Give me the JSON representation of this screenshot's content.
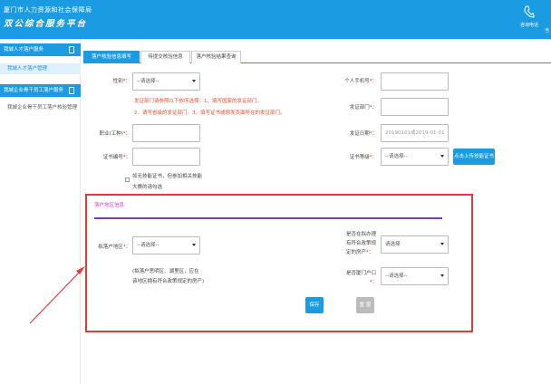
{
  "header": {
    "line1": "厦门市人力资源和社会保障局",
    "line2": "双公综合服务平台",
    "phone_label": "咨询电话",
    "edge_text": "当"
  },
  "sidebar": {
    "groups": [
      {
        "label": "我城人才落户服务",
        "subitems": [
          "我城人才落户管理"
        ]
      },
      {
        "label": "我城企业骨干员工落户服务",
        "subitems": [
          "我城企业骨干员工落户核验管理"
        ]
      }
    ]
  },
  "tabs": [
    "落户核验信息填写",
    "待提交核验信息",
    "落户核验结果查询"
  ],
  "form": {
    "gender_label": "性别",
    "select_placeholder": "--请选择--",
    "mobile_label": "个人手机号",
    "warn_line1": "发证部门请参照以下依序选择：1、填写国家的发证部门。",
    "warn_line2": "2、请写省级的发证部门。3、填写证书或颁发页面所在的发证部门。",
    "issuer_label": "发证部门",
    "job_label": "职业(工种)",
    "issue_date_label": "发证日期",
    "issue_date_placeholder": "20190101或2019-01-01",
    "cert_no_label": "证书编号",
    "cert_level_label": "证书等级",
    "upload_btn": "点击上传技能证书",
    "no_cert_note_1": "如无技能证书，但参加相关技能",
    "no_cert_note_2": "大赛的请勾选"
  },
  "section": {
    "title": "落户地区信息",
    "area_label": "拟落户地区",
    "area_note_1": "(拟落户思明区、湖里区，应在",
    "area_note_2": "该地区拥有符合政策规定的房产)",
    "house_q_1": "是否在拟办理",
    "house_q_2": "有符合政策规",
    "house_q_3": "定的房产",
    "hukou_q_1": "是否厦门户口",
    "save_btn": "保存",
    "reset_btn": "重 置"
  },
  "colors": {
    "brand": "#1a9be2",
    "warning": "#e84f2c",
    "required": "#e02020",
    "highlight_frame": "#e23a3a"
  },
  "icons": [
    "phone-icon",
    "document-icon",
    "chevron-down-icon",
    "arrow-annotation"
  ]
}
